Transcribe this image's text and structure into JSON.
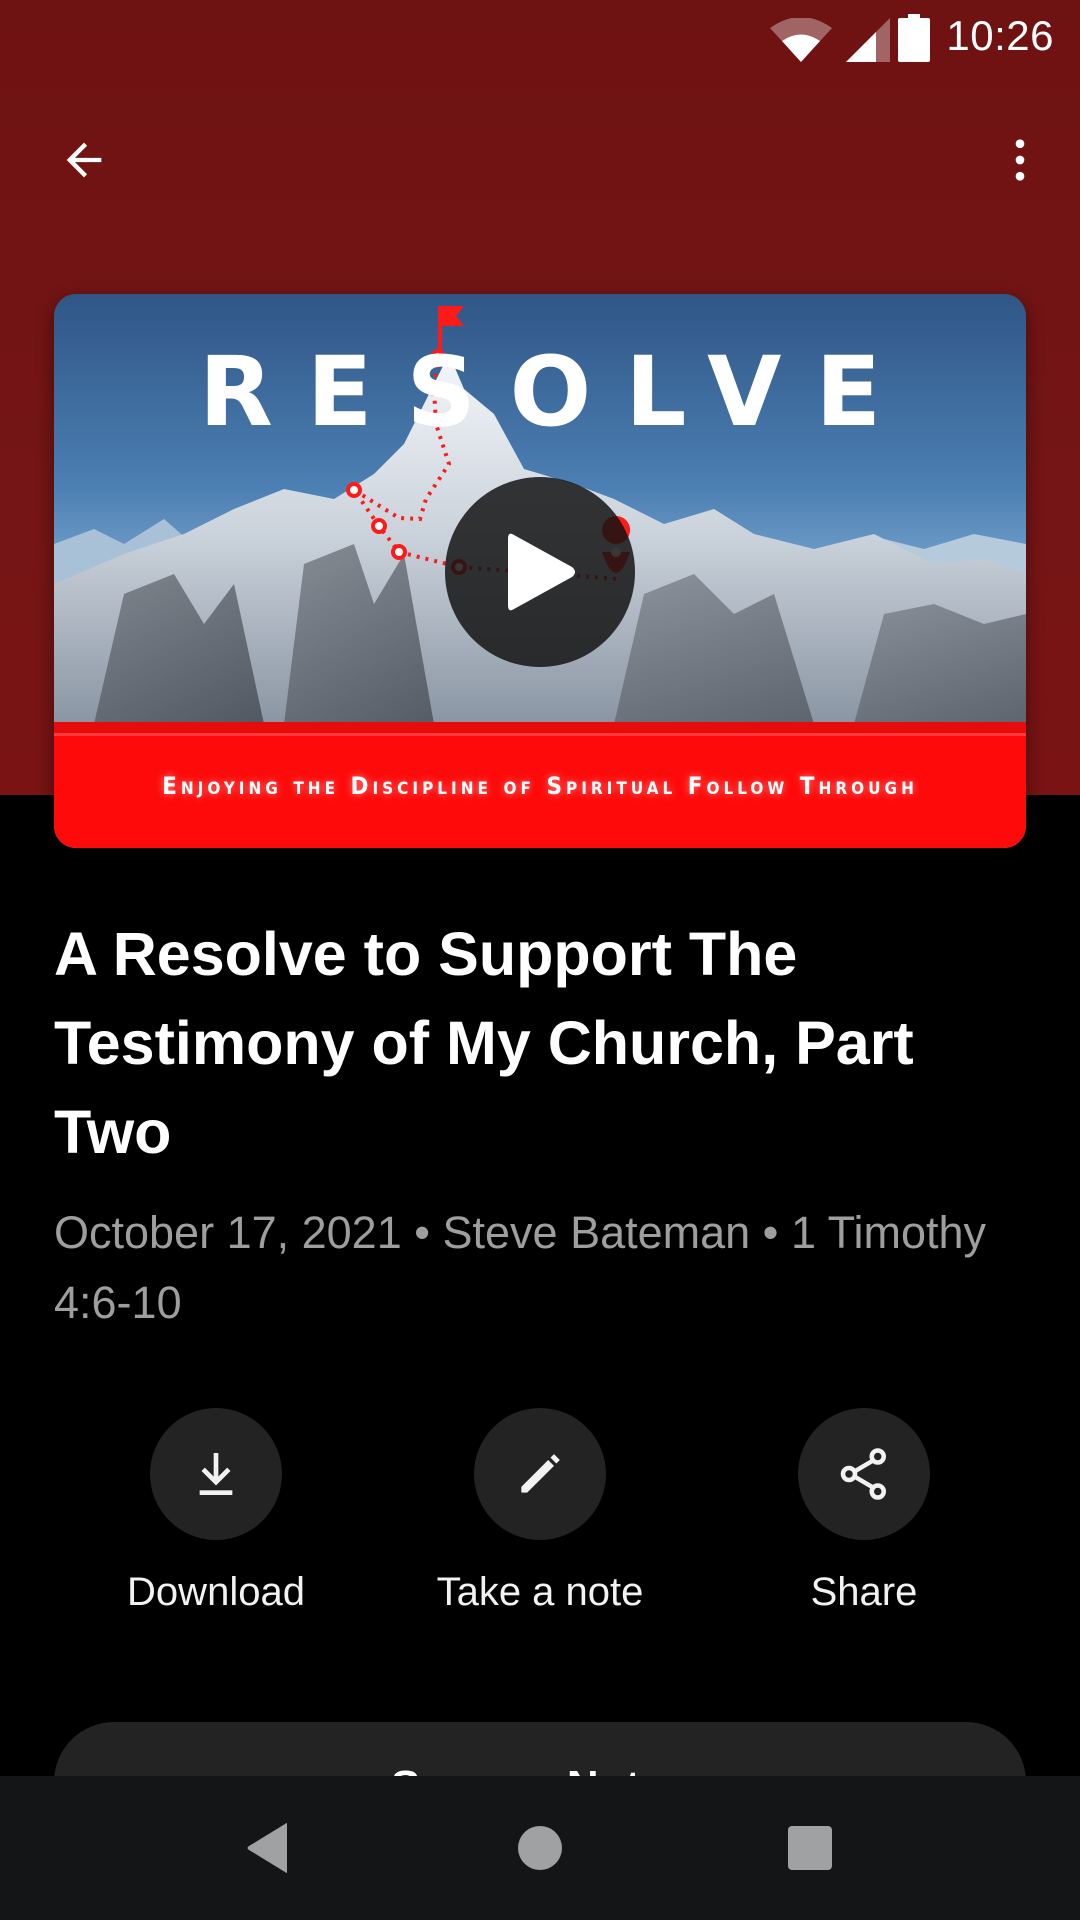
{
  "status_bar": {
    "time": "10:26",
    "icons": [
      "wifi-icon",
      "cellular-signal-icon",
      "battery-icon"
    ]
  },
  "app_bar": {
    "back_icon": "arrow-back-icon",
    "more_icon": "more-vertical-icon"
  },
  "artwork": {
    "series_title": "RESOLVE",
    "series_subtitle": "Enjoying the Discipline of Spiritual Follow Through",
    "play_icon": "play-icon"
  },
  "sermon": {
    "title": "A Resolve to Support The Testimony of My Church, Part Two",
    "meta": "October 17, 2021 • Steve Bateman • 1 Timothy 4:6-10"
  },
  "actions": [
    {
      "label": "Download",
      "icon": "download-icon"
    },
    {
      "label": "Take a note",
      "icon": "pencil-icon"
    },
    {
      "label": "Share",
      "icon": "share-icon"
    }
  ],
  "notes_button": {
    "label": "Sermon Notes"
  },
  "colors": {
    "header": "#751515",
    "accent_red": "#ff0a0a",
    "action_circle": "#232323",
    "meta_text": "#9e9e9e",
    "nav_bar": "#141517"
  },
  "nav_bar": {
    "items": [
      "back-triangle-icon",
      "home-circle-icon",
      "recents-square-icon"
    ]
  }
}
